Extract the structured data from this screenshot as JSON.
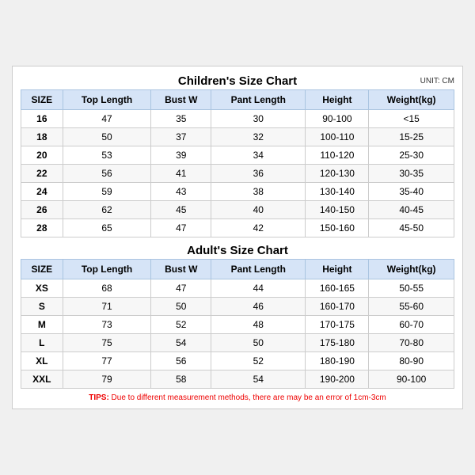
{
  "children": {
    "title": "Children's Size Chart",
    "unit": "UNIT: CM",
    "headers": [
      "SIZE",
      "Top Length",
      "Bust W",
      "Pant Length",
      "Height",
      "Weight(kg)"
    ],
    "rows": [
      [
        "16",
        "47",
        "35",
        "30",
        "90-100",
        "<15"
      ],
      [
        "18",
        "50",
        "37",
        "32",
        "100-110",
        "15-25"
      ],
      [
        "20",
        "53",
        "39",
        "34",
        "110-120",
        "25-30"
      ],
      [
        "22",
        "56",
        "41",
        "36",
        "120-130",
        "30-35"
      ],
      [
        "24",
        "59",
        "43",
        "38",
        "130-140",
        "35-40"
      ],
      [
        "26",
        "62",
        "45",
        "40",
        "140-150",
        "40-45"
      ],
      [
        "28",
        "65",
        "47",
        "42",
        "150-160",
        "45-50"
      ]
    ]
  },
  "adults": {
    "title": "Adult's Size Chart",
    "headers": [
      "SIZE",
      "Top Length",
      "Bust W",
      "Pant Length",
      "Height",
      "Weight(kg)"
    ],
    "rows": [
      [
        "XS",
        "68",
        "47",
        "44",
        "160-165",
        "50-55"
      ],
      [
        "S",
        "71",
        "50",
        "46",
        "160-170",
        "55-60"
      ],
      [
        "M",
        "73",
        "52",
        "48",
        "170-175",
        "60-70"
      ],
      [
        "L",
        "75",
        "54",
        "50",
        "175-180",
        "70-80"
      ],
      [
        "XL",
        "77",
        "56",
        "52",
        "180-190",
        "80-90"
      ],
      [
        "XXL",
        "79",
        "58",
        "54",
        "190-200",
        "90-100"
      ]
    ]
  },
  "tips": {
    "label": "TIPS:",
    "text": " Due to different measurement methods, there are may be an error of 1cm-3cm"
  }
}
